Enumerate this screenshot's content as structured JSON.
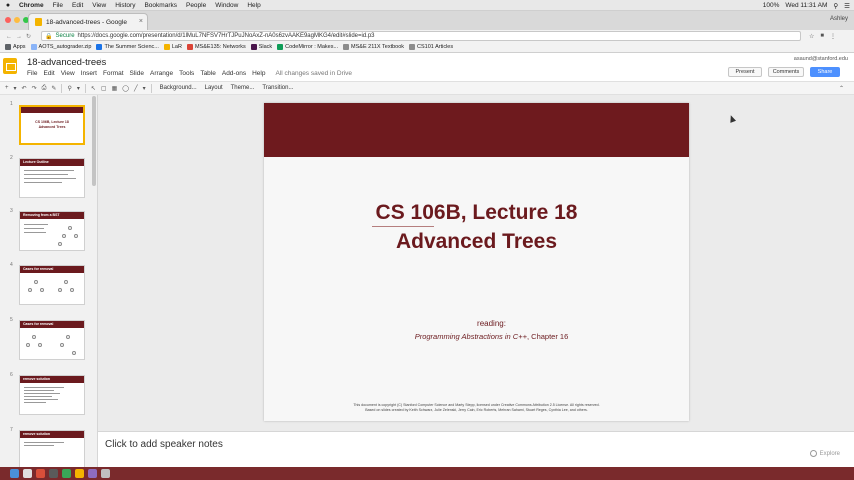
{
  "mac_menu": {
    "apple": "",
    "items": [
      "Chrome",
      "File",
      "Edit",
      "View",
      "History",
      "Bookmarks",
      "People",
      "Window",
      "Help"
    ],
    "clock": "Wed 11:31 AM",
    "battery": "100%"
  },
  "browser": {
    "tab_title": "18-advanced-trees - Google",
    "user": "Ashley",
    "secure_label": "Secure",
    "url": "https://docs.google.com/presentation/d/1lMuL7NFSV7HrTJPuJNoAxZ-nA0s6zvAAKE9agMKG4/edit#slide=id.p3"
  },
  "bookmarks": [
    {
      "label": "Apps",
      "color": "#5f6368"
    },
    {
      "label": "AOTS_autograder.zip",
      "color": "#8ab4f8"
    },
    {
      "label": "The Summer Scienc...",
      "color": "#1a73e8"
    },
    {
      "label": "LaR",
      "color": "#f4b400"
    },
    {
      "label": "MS&E135: Networks",
      "color": "#db4437"
    },
    {
      "label": "Slack",
      "color": "#4a154b"
    },
    {
      "label": "CodeMirror : Makes...",
      "color": "#0f9d58"
    },
    {
      "label": "MS&E 211X Textbook",
      "color": "#8c8c8c"
    },
    {
      "label": "CS101 Articles",
      "color": "#8c8c8c"
    }
  ],
  "docs": {
    "title": "18-advanced-trees",
    "menus": [
      "File",
      "Edit",
      "View",
      "Insert",
      "Format",
      "Slide",
      "Arrange",
      "Tools",
      "Table",
      "Add-ons",
      "Help"
    ],
    "saved_status": "All changes saved in Drive",
    "account": "asaund@stanford.edu",
    "present_label": "Present",
    "comments_label": "Comments",
    "share_label": "Share",
    "toolbar_text": [
      "Background...",
      "Layout",
      "Theme...",
      "Transition..."
    ]
  },
  "thumbnails": [
    {
      "num": "1",
      "title": "",
      "center": "CS 106B, Lecture 18\nAdvanced Trees",
      "type": "title"
    },
    {
      "num": "2",
      "title": "Lecture Outline",
      "type": "text"
    },
    {
      "num": "3",
      "title": "Removing from a BST",
      "type": "tree"
    },
    {
      "num": "4",
      "title": "Cases for removal",
      "type": "tree"
    },
    {
      "num": "5",
      "title": "Cases for removal",
      "type": "tree"
    },
    {
      "num": "6",
      "title": "remove solution",
      "type": "code"
    },
    {
      "num": "7",
      "title": "remove solution",
      "type": "code"
    }
  ],
  "slide": {
    "title_line1": "CS 106B, Lecture 18",
    "title_line2": "Advanced Trees",
    "reading_label": "reading:",
    "reading_book": "Programming Abstractions in C++",
    "reading_chapter": ", Chapter 16",
    "copyright_line1": "This document is copyright (C) Stanford Computer Science and Marty Stepp, licensed under Creative Commons Attribution 2.5 License.  All rights reserved.",
    "copyright_line2": "Based on slides created by Keith Schwarz, Julie Zelenski, Jerry Cain, Eric Roberts, Mehran Sahami, Stuart Reges, Cynthia Lee, and others.",
    "accent_color": "#6e1a1e"
  },
  "notes": {
    "placeholder": "Click to add speaker notes",
    "explore_label": "Explore"
  }
}
